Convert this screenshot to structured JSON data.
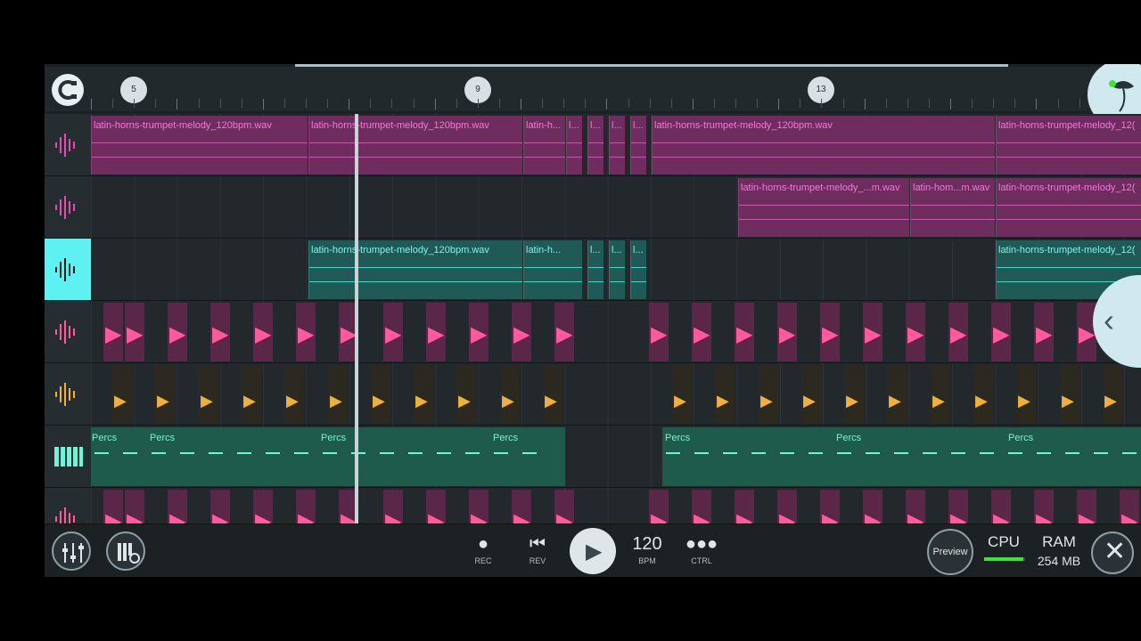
{
  "ruler": {
    "markers": [
      "5",
      "9",
      "13"
    ]
  },
  "tracks": [
    {
      "type": "audio",
      "color": "#e04fb0",
      "selected": false,
      "clips": [
        "latin-horns-trumpet-melody_120bpm.wav",
        "latin-horns-trumpet-melody_120bpm.wav",
        "latin-h...",
        "l...",
        "l...",
        "l...",
        "l...",
        "latin-horns-trumpet-melody_120bpm.wav",
        "latin-horns-trumpet-melody_12("
      ]
    },
    {
      "type": "audio",
      "color": "#e04fb0",
      "selected": false,
      "clips": [
        "latin-horns-trumpet-melody_...m.wav",
        "latin-hom...m.wav",
        "latin-horns-trumpet-melody_12("
      ]
    },
    {
      "type": "audio",
      "color": "#4fd1c5",
      "selected": true,
      "clips": [
        "latin-horns-trumpet-melody_120bpm.wav",
        "latin-h...",
        "l...",
        "l...",
        "l...",
        "latin-horns-trumpet-melody_12("
      ]
    },
    {
      "type": "drum",
      "color": "#ff5a9c",
      "selected": false
    },
    {
      "type": "drum",
      "color": "#f0b040",
      "selected": false
    },
    {
      "type": "instrument",
      "color": "#6ff5d8",
      "selected": false,
      "clips": [
        "Percs",
        "Percs",
        "Percs",
        "Percs",
        "Percs",
        "Percs",
        "Percs"
      ]
    },
    {
      "type": "drum",
      "color": "#ff5a9c",
      "selected": false
    }
  ],
  "transport": {
    "rec_label": "REC",
    "rev_label": "REV",
    "tempo": "120",
    "bpm_label": "BPM",
    "ctrl_label": "CTRL",
    "preview_label": "Preview",
    "cpu_label": "CPU",
    "cpu_level": 0.95,
    "ram_label": "RAM",
    "ram_value": "254 MB"
  },
  "icons": {
    "snap": "magnet-icon",
    "mixer": "mixer-icon",
    "plugins": "piano-settings-icon",
    "rec": "record-icon",
    "rev": "rewind-icon",
    "play": "play-icon",
    "ctrl": "more-dots-icon",
    "close": "close-icon",
    "side": "chevron-left-icon"
  }
}
